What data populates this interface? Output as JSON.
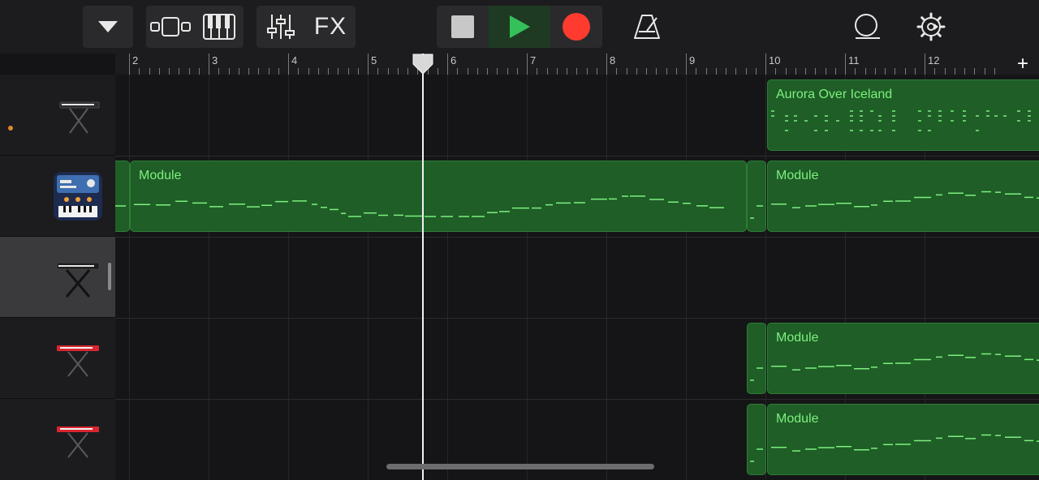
{
  "toolbar": {
    "fx_label": "FX",
    "accent_play": "#35c15a",
    "accent_record": "#ff3b30"
  },
  "ruler": {
    "bars": [
      "2",
      "3",
      "4",
      "5",
      "6",
      "7",
      "8",
      "9",
      "10",
      "11",
      "12"
    ],
    "add_label": "+"
  },
  "tracks": [
    {
      "instrument": "keyboard-icon",
      "has_indicator": true
    },
    {
      "instrument": "synth-module-icon"
    },
    {
      "instrument": "keyboard-icon",
      "selected": true
    },
    {
      "instrument": "red-keyboard-icon"
    },
    {
      "instrument": "red-keyboard-icon"
    }
  ],
  "regions": {
    "r1": {
      "title": "Aurora Over Iceland"
    },
    "r2a": {
      "title": ""
    },
    "r2b": {
      "title": "Module"
    },
    "r2c": {
      "title": ""
    },
    "r2d": {
      "title": "Module"
    },
    "r4a": {
      "title": ""
    },
    "r4b": {
      "title": "Module"
    },
    "r5a": {
      "title": ""
    },
    "r5b": {
      "title": "Module"
    }
  },
  "colors": {
    "region_fill": "#1f5e27",
    "region_text": "#7cf07e",
    "background": "#141416"
  }
}
